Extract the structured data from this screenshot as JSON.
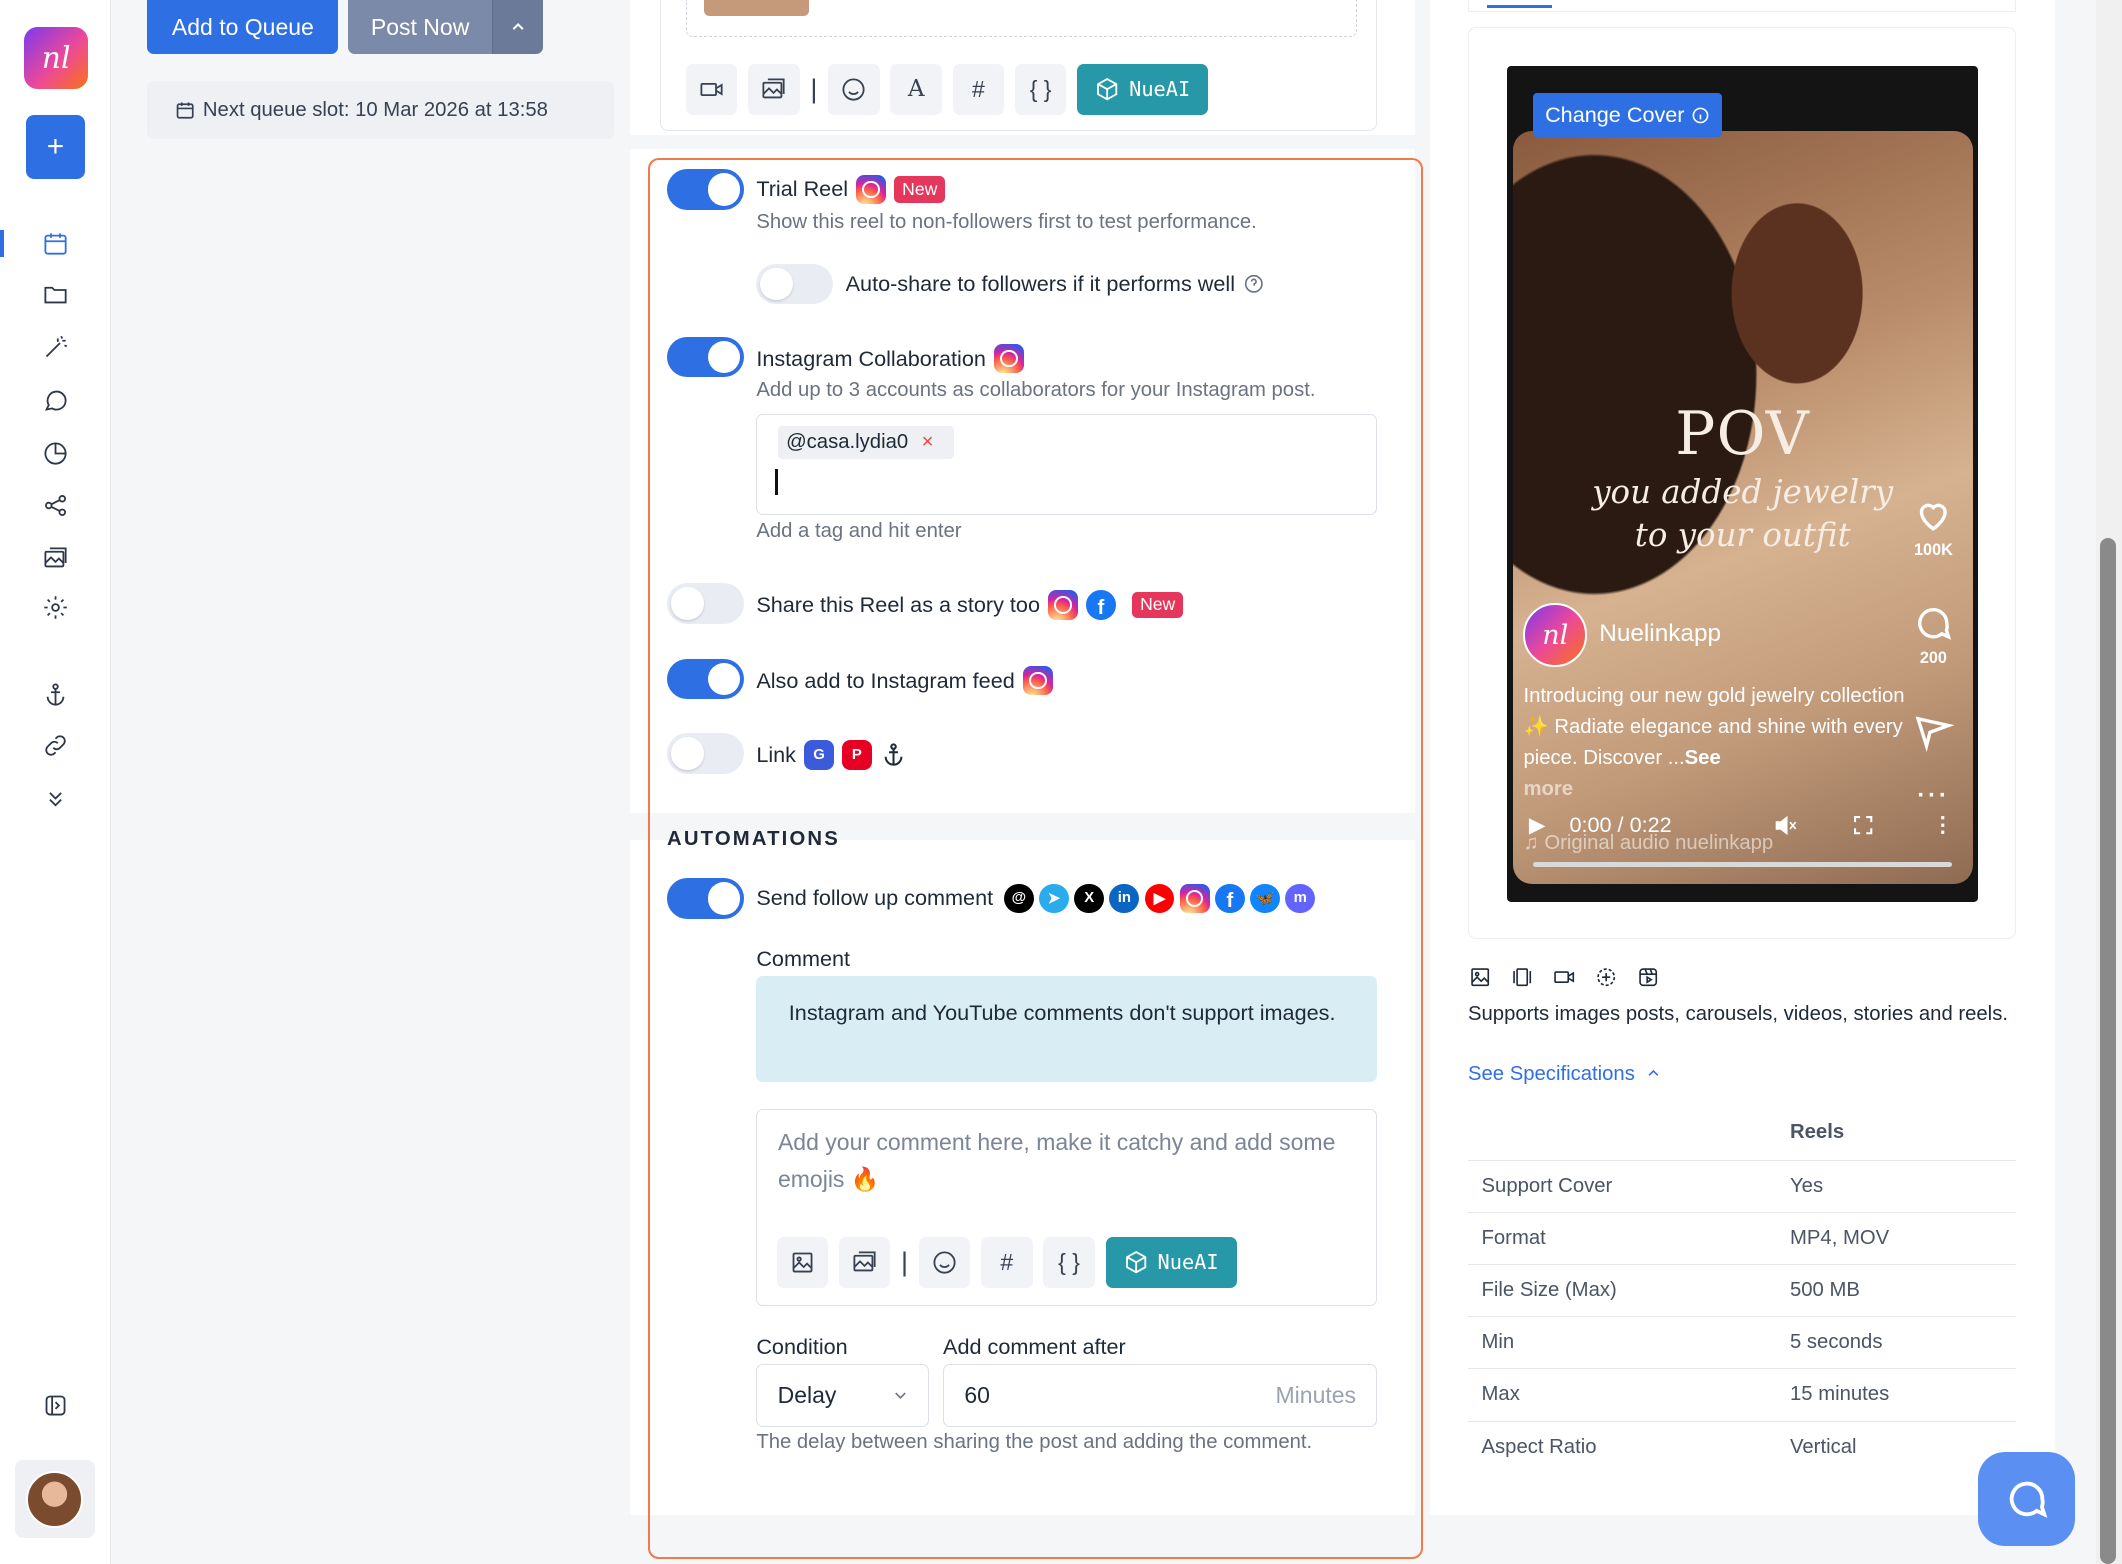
{
  "sidebar": {
    "logo_text": "nl",
    "plus_label": "+",
    "icons": [
      "calendar-icon",
      "folder-icon",
      "magic-wand-icon",
      "chat-icon",
      "pie-chart-icon",
      "share-icon",
      "images-icon",
      "gear-icon",
      "anchor-icon",
      "link-icon",
      "chevrons-down-icon"
    ]
  },
  "toolbar": {
    "add_to_queue": "Add to Queue",
    "post_now": "Post Now",
    "next_slot": "Next queue slot: 10 Mar 2026 at 13:58"
  },
  "editor_toolbar": {
    "separator": "|",
    "hash": "#",
    "braces": "{ }",
    "font_letter": "A",
    "ai_label": "NueAI"
  },
  "options": {
    "trial_reel": {
      "label": "Trial Reel",
      "badge": "New",
      "desc": "Show this reel to non-followers first to test performance.",
      "enabled": true
    },
    "auto_share": {
      "label": "Auto-share to followers if it performs well",
      "enabled": false
    },
    "collab": {
      "label": "Instagram Collaboration",
      "desc": "Add up to 3 accounts as collaborators for your Instagram post.",
      "enabled": true,
      "tag": "@casa.lydia0",
      "remove": "×",
      "hint": "Add a tag and hit enter"
    },
    "story": {
      "label": "Share this Reel as a story too",
      "badge": "New",
      "enabled": false
    },
    "feed": {
      "label": "Also add to Instagram feed",
      "enabled": true
    },
    "link": {
      "label": "Link",
      "enabled": false
    }
  },
  "automations": {
    "heading": "AUTOMATIONS",
    "follow_up": {
      "label": "Send follow up comment",
      "enabled": true
    },
    "comment_label": "Comment",
    "info": "Instagram and YouTube comments don't support images.",
    "comment_placeholder": "Add your comment here, make it catchy and add some emojis 🔥",
    "condition_label": "Condition",
    "condition_value": "Delay",
    "after_label": "Add comment after",
    "after_value": "60",
    "after_unit": "Minutes",
    "help": "The delay between sharing the post and adding the comment."
  },
  "preview": {
    "change_cover": "Change Cover",
    "pov_title": "POV",
    "pov_line1": "you added jewelry",
    "pov_line2": "to your outfit",
    "likes": "100K",
    "comments": "200",
    "profile_initials": "nl",
    "profile_name": "Nuelinkapp",
    "caption_pre": "Introducing our new gold jewelry collection ✨ Radiate elegance and shine with every piece. Discover ...",
    "caption_see": "See",
    "caption_more": "more",
    "time": "0:00 / 0:22",
    "audio": "Original audio nuelinkapp"
  },
  "specs": {
    "supports": "Supports images posts, carousels, videos, stories and reels.",
    "see_spec": "See Specifications",
    "col_header": "Reels",
    "rows": [
      {
        "k": "Support Cover",
        "v": "Yes"
      },
      {
        "k": "Format",
        "v": "MP4, MOV"
      },
      {
        "k": "File Size (Max)",
        "v": "500 MB"
      },
      {
        "k": "Min",
        "v": "5 seconds"
      },
      {
        "k": "Max",
        "v": "15 minutes"
      },
      {
        "k": "Aspect Ratio",
        "v": "Vertical"
      }
    ]
  },
  "colors": {
    "accent": "#2f6fe4",
    "ai": "#2798a8",
    "highlight": "#ef7a4a",
    "badge": "#e5375c"
  }
}
